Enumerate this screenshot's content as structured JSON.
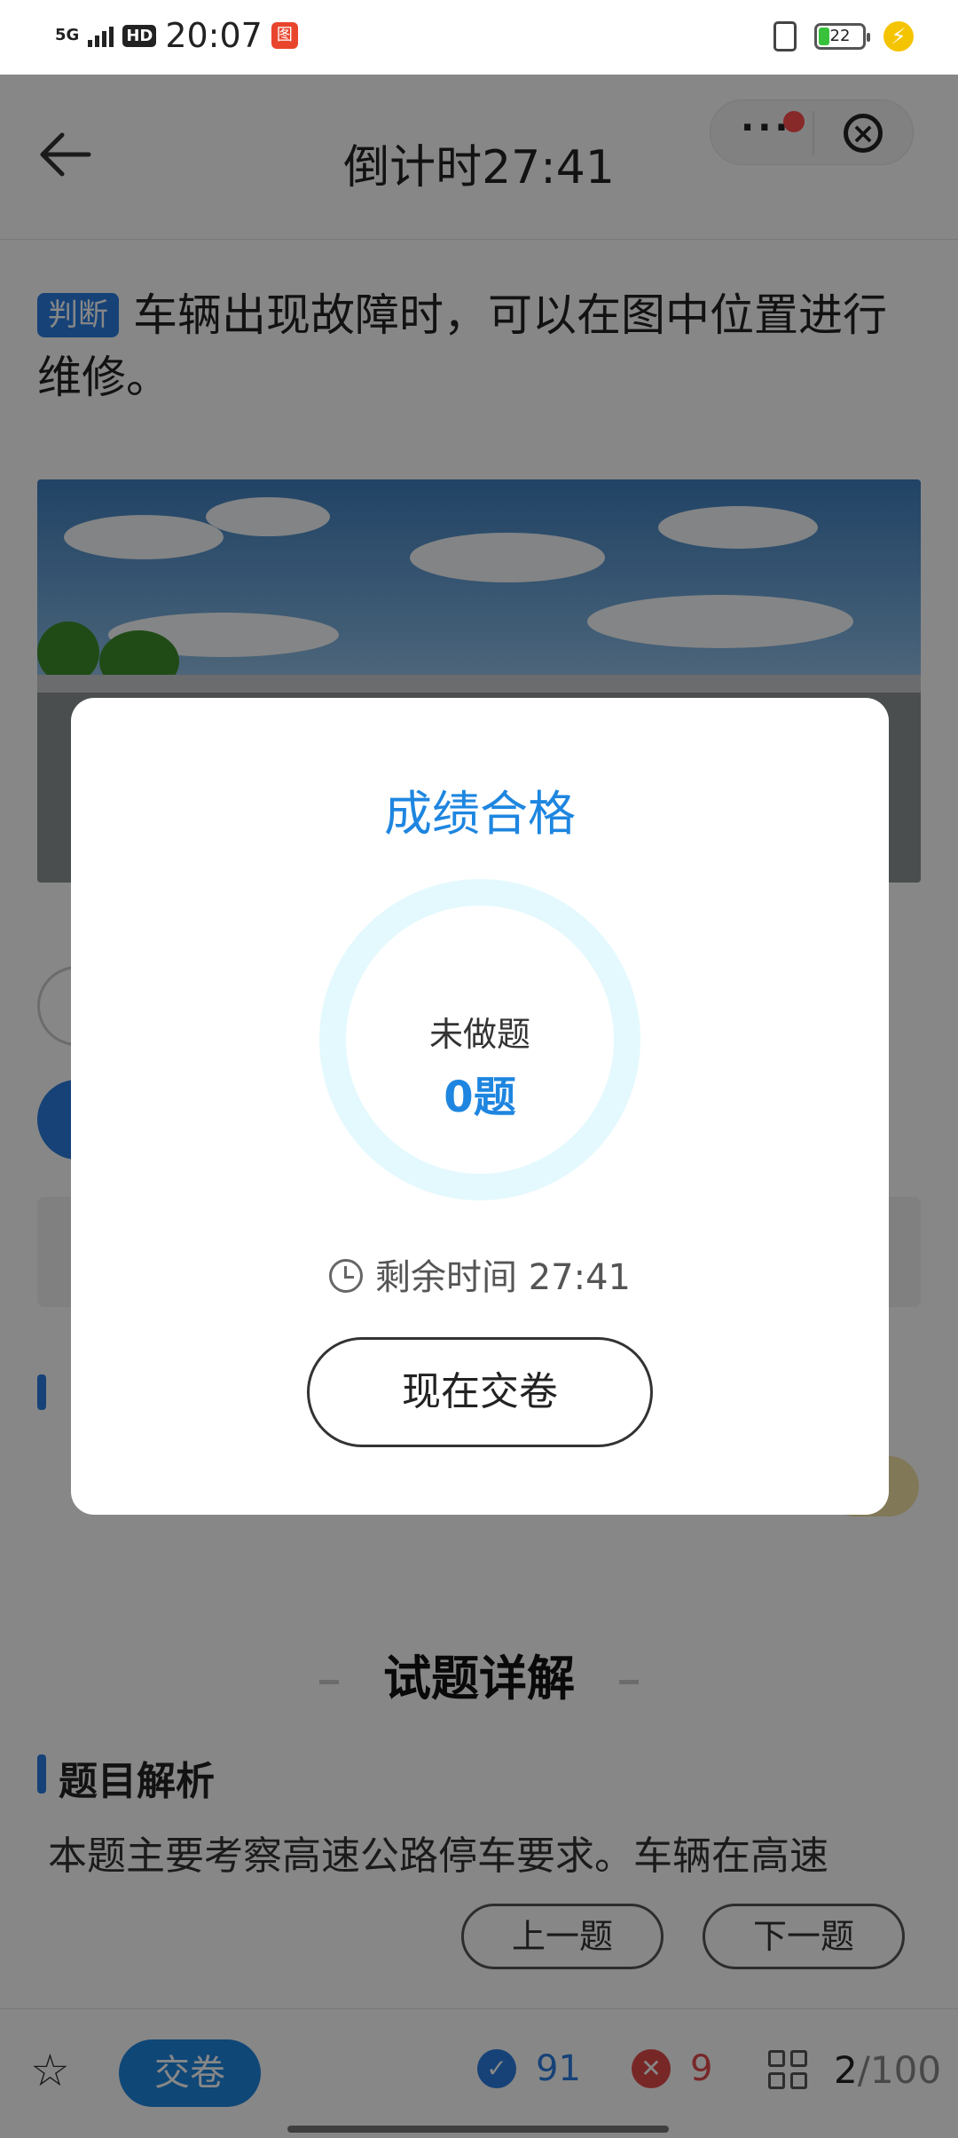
{
  "status_bar": {
    "network": "5G",
    "hd_badge": "HD",
    "time": "20:07",
    "battery": "22"
  },
  "header": {
    "title": "倒计时27:41"
  },
  "question": {
    "tag": "判断",
    "text": "车辆出现故障时，可以在图中位置进行维修。"
  },
  "explanation": {
    "section_title": "试题详解",
    "analysis_heading": "题目解析",
    "analysis_text": "本题主要考察高速公路停车要求。车辆在高速"
  },
  "navigation": {
    "prev_label": "上一题",
    "next_label": "下一题"
  },
  "bottom_bar": {
    "submit_label": "交卷",
    "correct_count": "91",
    "wrong_count": "9",
    "current": "2",
    "total": "/100"
  },
  "modal": {
    "title": "成绩合格",
    "ring_label": "未做题",
    "ring_value": "0题",
    "remaining_time": "剩余时间 27:41",
    "submit_now_label": "现在交卷"
  },
  "colors": {
    "accent": "#1e86e0",
    "correct": "#2b7de0",
    "wrong": "#e34a4a",
    "ring": "#e4f9fd"
  }
}
